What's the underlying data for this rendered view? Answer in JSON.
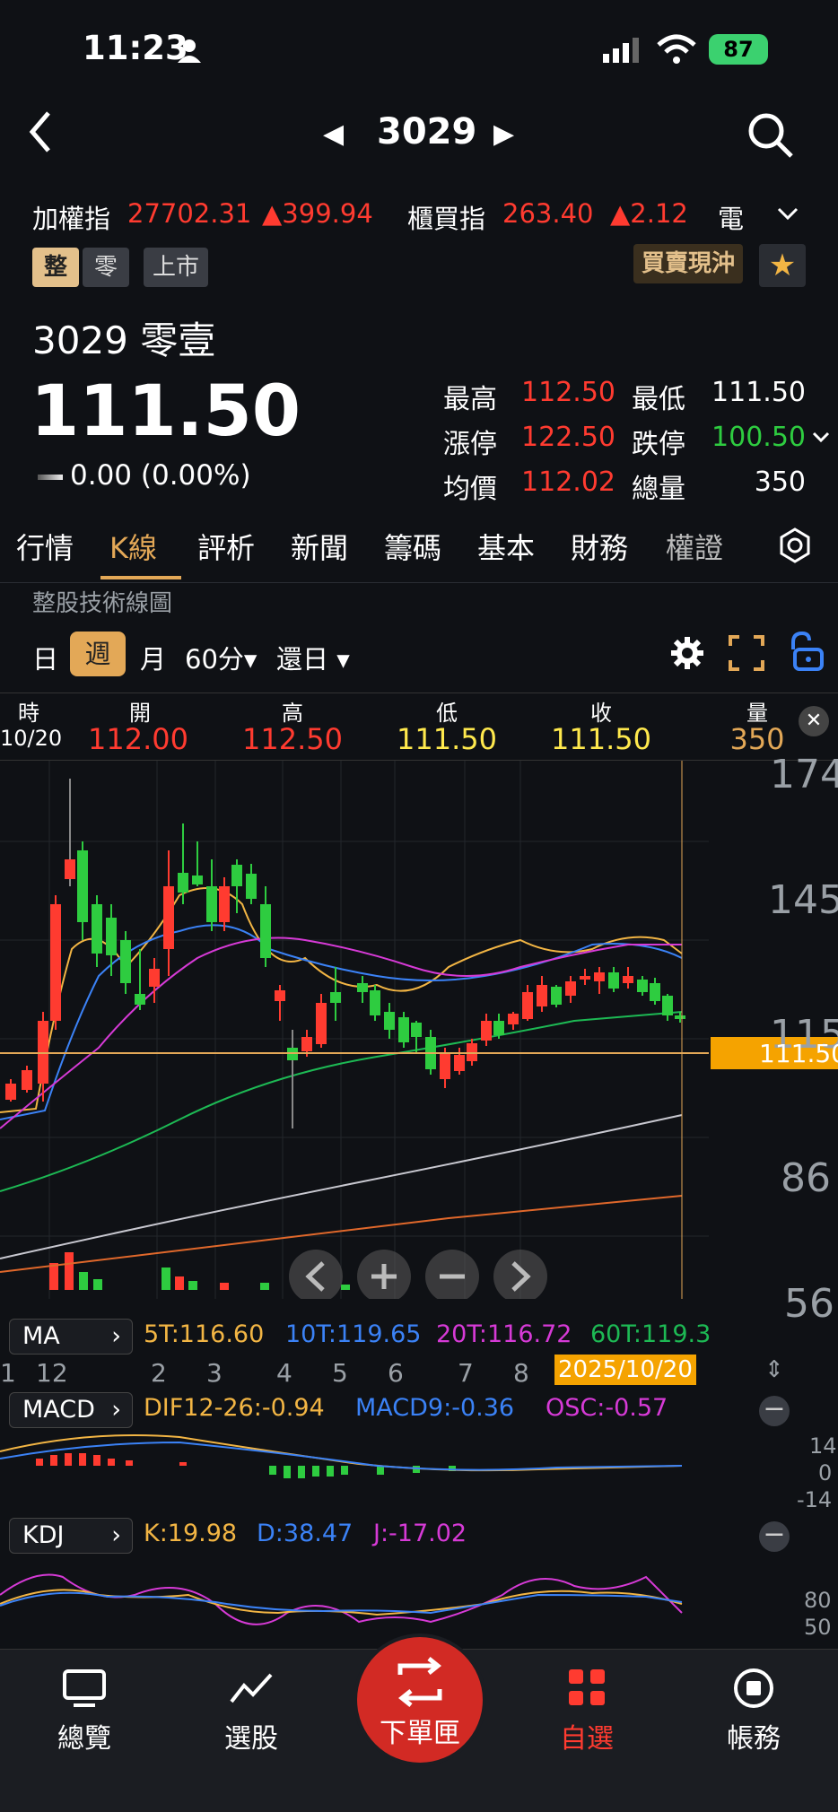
{
  "status": {
    "time": "11:23",
    "battery": "87"
  },
  "nav": {
    "code": "3029"
  },
  "ticker": [
    {
      "name": "加權指",
      "value": "27702.31",
      "change": "▲399.94"
    },
    {
      "name": "櫃買指",
      "value": "263.40",
      "change": "▲2.12"
    },
    {
      "name": "電",
      "value": "",
      "change": ""
    }
  ],
  "badges": {
    "whole": "整",
    "odd": "零",
    "market": "上市",
    "day_trade": "買賣現沖"
  },
  "stock": {
    "name": "3029 零壹",
    "price": "111.50",
    "change": "0.00 (0.00%)"
  },
  "stats": [
    {
      "label": "最高",
      "value": "112.50",
      "color": "red"
    },
    {
      "label": "最低",
      "value": "111.50",
      "color": "white"
    },
    {
      "label": "漲停",
      "value": "122.50",
      "color": "red"
    },
    {
      "label": "跌停",
      "value": "100.50",
      "color": "green"
    },
    {
      "label": "均價",
      "value": "112.02",
      "color": "red"
    },
    {
      "label": "總量",
      "value": "350",
      "color": "white"
    }
  ],
  "tabs": [
    "行情",
    "K線",
    "評析",
    "新聞",
    "籌碼",
    "基本",
    "財務",
    "權證"
  ],
  "section_label": "整股技術線圖",
  "periods": {
    "day": "日",
    "week": "週",
    "month": "月",
    "min60": "60分▾",
    "restore": "還日 ▾"
  },
  "ohlc": {
    "headers": [
      "時",
      "開",
      "高",
      "低",
      "收",
      "量"
    ],
    "date": "10/20",
    "open": "112.00",
    "high": "112.50",
    "low": "111.50",
    "close": "111.50",
    "volume": "350"
  },
  "chart_data": {
    "type": "candlestick",
    "y_ticks": [
      "174",
      "145",
      "115",
      "86",
      "56"
    ],
    "current_price_label": "111.50",
    "x_labels": [
      "1",
      "12",
      "2",
      "3",
      "4",
      "5",
      "6",
      "7",
      "8",
      "2025/10/20"
    ]
  },
  "ma": {
    "button": "MA",
    "ma5": "5T:116.60",
    "ma10": "10T:119.65",
    "ma20": "20T:116.72",
    "ma60": "60T:119.3"
  },
  "macd": {
    "button": "MACD",
    "dif": "DIF12-26:-0.94",
    "macd9": "MACD9:-0.36",
    "osc": "OSC:-0.57",
    "axis": [
      "14",
      "0",
      "-14"
    ]
  },
  "kdj": {
    "button": "KDJ",
    "k": "K:19.98",
    "d": "D:38.47",
    "j": "J:-17.02",
    "axis": [
      "80",
      "50"
    ]
  },
  "bottom_nav": [
    {
      "label": "總覽",
      "icon": "monitor-icon"
    },
    {
      "label": "選股",
      "icon": "trend-line-icon"
    },
    {
      "label": "下單匣",
      "icon": "swap-icon"
    },
    {
      "label": "自選",
      "icon": "grid-icon"
    },
    {
      "label": "帳務",
      "icon": "record-icon"
    }
  ],
  "colors": {
    "accent": "#e3a857",
    "up": "#ff3b30",
    "down": "#2ecc40",
    "order": "#d22a24"
  }
}
